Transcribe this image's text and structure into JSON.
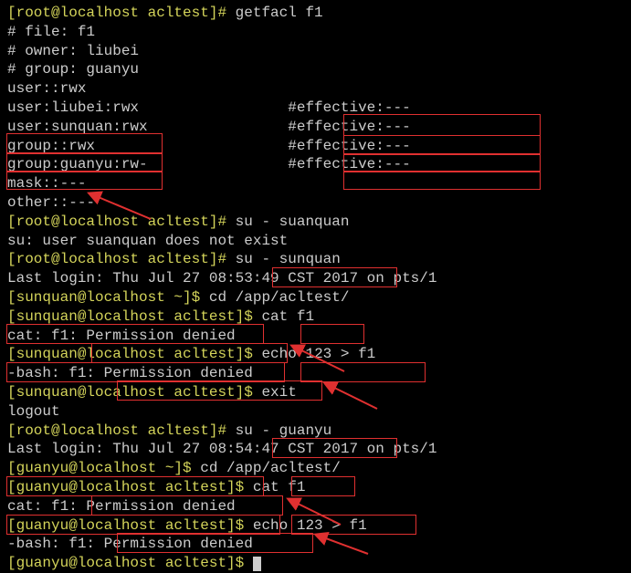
{
  "lines": {
    "l1_host": "[root@localhost acltest]# ",
    "l1_cmd": "getfacl f1",
    "l2": "# file: f1",
    "l3": "# owner: liubei",
    "l4": "# group: guanyu",
    "l5": "user::rwx",
    "l6a": "user:liubei:rwx                 ",
    "l6b": "#effective:---",
    "l7a": "user:sunquan:rwx                ",
    "l7b": "#effective:---",
    "l8a": "group::rwx                      ",
    "l8b": "#effective:---",
    "l9a": "group:guanyu:rw-                ",
    "l9b": "#effective:---",
    "l10": "mask::---",
    "l11": "other::---",
    "l12": "",
    "l13_host": "[root@localhost acltest]# ",
    "l13_cmd": "su - suanquan",
    "l14": "su: user suanquan does not exist",
    "l15_host": "[root@localhost acltest]# ",
    "l15_cmd": "su - sunquan",
    "l16": "Last login: Thu Jul 27 08:53:49 CST 2017 on pts/1",
    "l17_host": "[sunquan@localhost ~]$ ",
    "l17_cmd": "cd /app/acltest/",
    "l18_host": "[sunquan@localhost acltest]$ ",
    "l18_cmd": "cat f1",
    "l19": "cat: f1: Permission denied",
    "l20_host": "[sunquan@localhost acltest]$ ",
    "l20_cmd": "echo 123 > f1",
    "l21": "-bash: f1: Permission denied",
    "l22_host": "[sunquan@localhost acltest]$ ",
    "l22_cmd": "exit",
    "l23": "logout",
    "l24_host": "[root@localhost acltest]# ",
    "l24_cmd": "su - guanyu",
    "l25": "Last login: Thu Jul 27 08:54:47 CST 2017 on pts/1",
    "l26_host": "[guanyu@localhost ~]$ ",
    "l26_cmd": "cd /app/acltest/",
    "l27_host": "[guanyu@localhost acltest]$ ",
    "l27_cmd": "cat f1",
    "l28": "cat: f1: Permission denied",
    "l29_host": "[guanyu@localhost acltest]$ ",
    "l29_cmd": "echo 123 > f1",
    "l30": "-bash: f1: Permission denied",
    "l31_host": "[guanyu@localhost acltest]$ "
  }
}
